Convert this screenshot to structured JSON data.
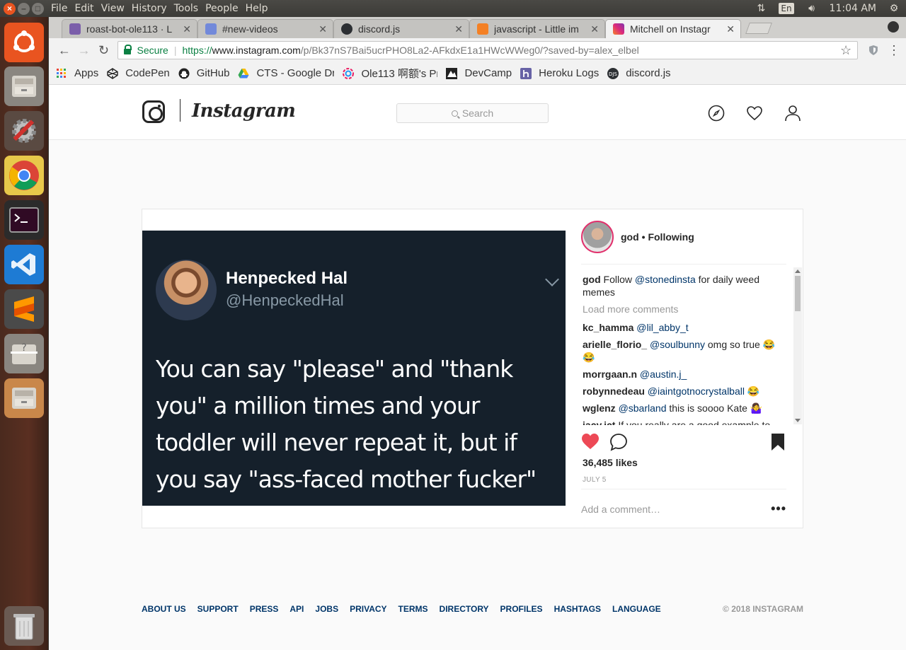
{
  "system": {
    "menu": [
      "File",
      "Edit",
      "View",
      "History",
      "Tools",
      "People",
      "Help"
    ],
    "lang": "En",
    "time": "11:04 AM"
  },
  "tabs": [
    {
      "title": "roast-bot-ole113 · L",
      "icon": "heroku-icon"
    },
    {
      "title": "#new-videos",
      "icon": "discord-icon"
    },
    {
      "title": "discord.js",
      "icon": "discordjs-icon"
    },
    {
      "title": "javascript - Little im",
      "icon": "stackoverflow-icon"
    },
    {
      "title": "Mitchell on Instagr",
      "icon": "instagram-icon"
    }
  ],
  "address": {
    "secure_label": "Secure",
    "scheme": "https://",
    "host": "www.instagram.com",
    "path": "/p/Bk37nS7Bai5ucrPHO8La2-AFkdxE1a1HWcWWeg0/?saved-by=alex_elbel"
  },
  "bookmarks": [
    "Apps",
    "CodePen",
    "GitHub",
    "CTS - Google Dri",
    "Ole113 啊额's Pr",
    "DevCamp",
    "Heroku Logs",
    "discord.js"
  ],
  "ig": {
    "wordmark": "Instagram",
    "search_placeholder": "Search"
  },
  "post": {
    "tweet": {
      "name": "Henpecked Hal",
      "handle": "@HenpeckedHal",
      "text": "You can say \"please\" and \"thank you\" a million times and your toddler will never repeat it, but if you say \"ass-faced mother fucker\" ONCE..."
    },
    "author": "god",
    "follow_label": "• Following",
    "caption": {
      "user": "god",
      "pre": "Follow ",
      "mention": "@stonedinsta",
      "post": " for daily weed memes"
    },
    "load_more": "Load more comments",
    "comments": [
      {
        "user": "kc_hamma",
        "mention": "@lil_abby_t",
        "text": ""
      },
      {
        "user": "arielle_florio_",
        "mention": "@soulbunny",
        "text": " omg so true 😂😂"
      },
      {
        "user": "morrgaan.n",
        "mention": "@austin.j_",
        "text": ""
      },
      {
        "user": "robynnedeau",
        "mention": "@iaintgotnocrystalball",
        "text": " 😂"
      },
      {
        "user": "wglenz",
        "mention": "@sbarland",
        "text": " this is soooo Kate 🤷‍♀️"
      },
      {
        "user": "jacy.jct",
        "mention": "",
        "text": " If you really are a good example to"
      }
    ],
    "likes": "36,485 likes",
    "date": "JULY 5",
    "add_comment": "Add a comment…"
  },
  "footer": {
    "links": [
      "ABOUT US",
      "SUPPORT",
      "PRESS",
      "API",
      "JOBS",
      "PRIVACY",
      "TERMS",
      "DIRECTORY",
      "PROFILES",
      "HASHTAGS",
      "LANGUAGE"
    ],
    "copyright": "© 2018 INSTAGRAM"
  }
}
